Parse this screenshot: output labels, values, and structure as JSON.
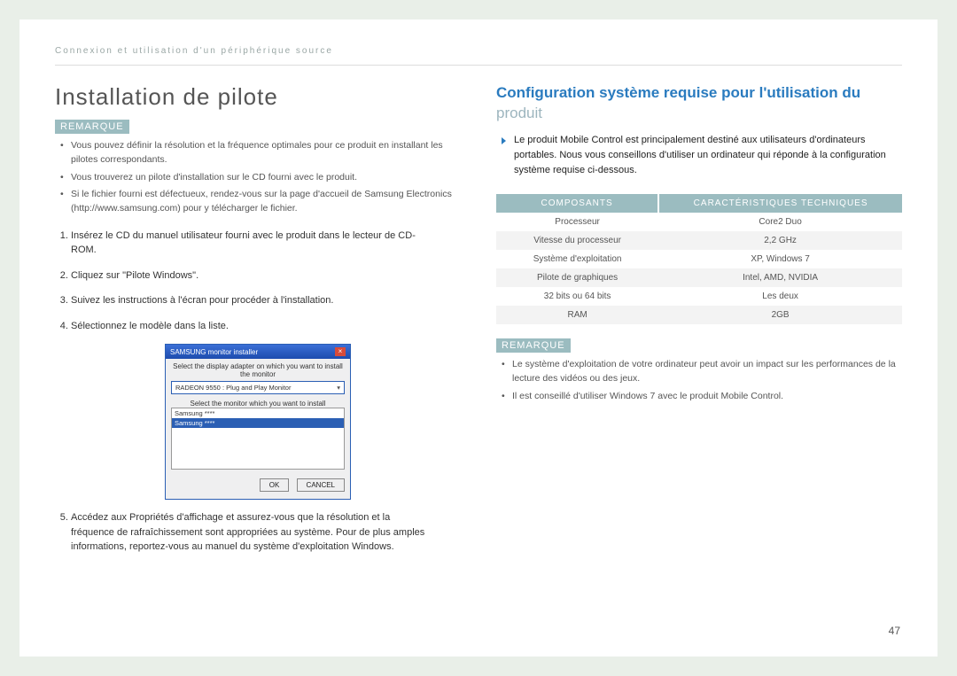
{
  "breadcrumb": "Connexion et utilisation d'un périphérique source",
  "left": {
    "title": "Installation de pilote",
    "remarque_label": "REMARQUE",
    "notes": [
      "Vous pouvez définir la résolution et la fréquence optimales pour ce produit en installant les pilotes correspondants.",
      "Vous trouverez un pilote d'installation sur le CD fourni avec le produit.",
      "Si le fichier fourni est défectueux, rendez-vous sur la page d'accueil de Samsung Electronics (http://www.samsung.com) pour y télécharger le fichier."
    ],
    "steps": [
      "Insérez le CD du manuel utilisateur fourni avec le produit dans le lecteur de CD-ROM.",
      "Cliquez sur \"Pilote Windows\".",
      "Suivez les instructions à l'écran pour procéder à l'installation.",
      "Sélectionnez le modèle dans la liste.",
      "Accédez aux Propriétés d'affichage et assurez-vous que la résolution et la fréquence de rafraîchissement sont appropriées au système. Pour de plus amples informations, reportez-vous au manuel du système d'exploitation Windows."
    ],
    "dialog": {
      "title": "SAMSUNG monitor installer",
      "line1": "Select the display adapter on which you want to install the monitor",
      "select_value": "RADEON 9550 : Plug and Play Monitor",
      "line2": "Select the monitor which you want to install",
      "list_item1": "Samsung ****",
      "list_item2": "Samsung ****",
      "btn_ok": "OK",
      "btn_cancel": "CANCEL"
    }
  },
  "right": {
    "title": "Configuration système requise pour l'utilisation du",
    "subtitle": "produit",
    "intro": "Le produit Mobile Control est principalement destiné aux utilisateurs d'ordinateurs portables. Nous vous conseillons d'utiliser un ordinateur qui réponde à la configuration système requise ci-dessous.",
    "th1": "COMPOSANTS",
    "th2": "CARACTÉRISTIQUES TECHNIQUES",
    "rows": [
      {
        "k": "Processeur",
        "v": "Core2 Duo"
      },
      {
        "k": "Vitesse du processeur",
        "v": "2,2 GHz"
      },
      {
        "k": "Système d'exploitation",
        "v": "XP, Windows 7"
      },
      {
        "k": "Pilote de graphiques",
        "v": "Intel, AMD, NVIDIA"
      },
      {
        "k": "32 bits ou 64 bits",
        "v": "Les deux"
      },
      {
        "k": "RAM",
        "v": "2GB"
      }
    ],
    "remarque_label": "REMARQUE",
    "notes2": [
      "Le système d'exploitation de votre ordinateur peut avoir un impact sur les performances de la lecture des vidéos ou des jeux.",
      "Il est conseillé d'utiliser Windows 7 avec le produit Mobile Control."
    ]
  },
  "page_number": "47"
}
